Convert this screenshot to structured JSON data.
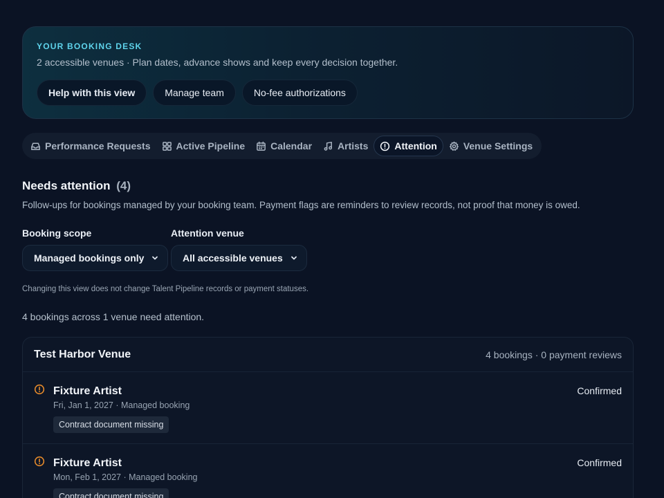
{
  "hero": {
    "eyebrow": "YOUR BOOKING DESK",
    "subtitle": "2 accessible venues · Plan dates, advance shows and keep every decision together.",
    "actions": [
      {
        "label": "Help with this view"
      },
      {
        "label": "Manage team"
      },
      {
        "label": "No-fee authorizations"
      }
    ]
  },
  "tabs": [
    {
      "label": "Performance Requests",
      "icon": "inbox-icon",
      "active": false
    },
    {
      "label": "Active Pipeline",
      "icon": "grid-icon",
      "active": false
    },
    {
      "label": "Calendar",
      "icon": "calendar-icon",
      "active": false
    },
    {
      "label": "Artists",
      "icon": "music-note-icon",
      "active": false
    },
    {
      "label": "Attention",
      "icon": "alert-circle-icon",
      "active": true
    },
    {
      "label": "Venue Settings",
      "icon": "gear-icon",
      "active": false
    }
  ],
  "attention": {
    "title": "Needs attention",
    "count": "(4)",
    "description": "Follow-ups for bookings managed by your booking team. Payment flags are reminders to review records, not proof that money is owed.",
    "filters": {
      "scope_label": "Booking scope",
      "scope_value": "Managed bookings only",
      "venue_label": "Attention venue",
      "venue_value": "All accessible venues"
    },
    "note": "Changing this view does not change Talent Pipeline records or payment statuses.",
    "summary": "4 bookings across 1 venue need attention."
  },
  "venue": {
    "name": "Test Harbor Venue",
    "meta": "4 bookings · 0 payment reviews",
    "bookings": [
      {
        "artist": "Fixture Artist",
        "date": "Fri, Jan 1, 2027 · Managed booking",
        "tag": "Contract document missing",
        "status": "Confirmed"
      },
      {
        "artist": "Fixture Artist",
        "date": "Mon, Feb 1, 2027 · Managed booking",
        "tag": "Contract document missing",
        "status": "Confirmed"
      }
    ]
  },
  "colors": {
    "background": "#0b1324",
    "accent": "#5fd4ec",
    "warning": "#e58a2b"
  }
}
